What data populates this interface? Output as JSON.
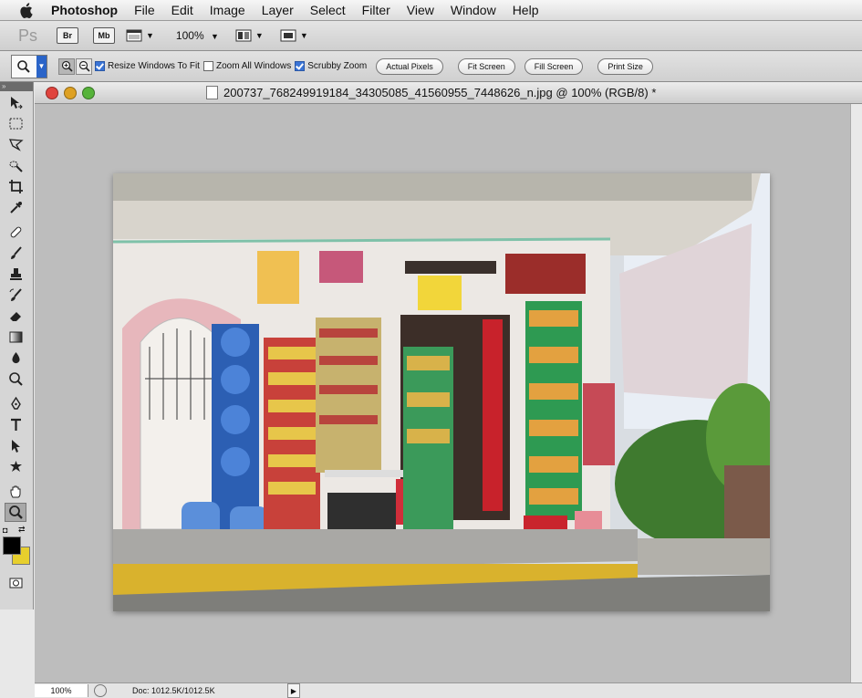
{
  "menubar": {
    "apple_icon": "apple-logo-icon",
    "items": [
      "Photoshop",
      "File",
      "Edit",
      "Image",
      "Layer",
      "Select",
      "Filter",
      "View",
      "Window",
      "Help"
    ]
  },
  "appbar": {
    "ps_logo": "Ps",
    "bridge": "Br",
    "mini_bridge": "Mb",
    "zoom": "100%"
  },
  "options": {
    "resize_windows": "Resize Windows To Fit",
    "resize_checked": true,
    "zoom_all": "Zoom All Windows",
    "zoom_all_checked": false,
    "scrubby": "Scrubby Zoom",
    "scrubby_checked": true,
    "actual_pixels": "Actual Pixels",
    "fit_screen": "Fit Screen",
    "fill_screen": "Fill Screen",
    "print_size": "Print Size"
  },
  "document": {
    "title": "200737_768249919184_34305085_41560955_7448626_n.jpg @ 100% (RGB/8) *"
  },
  "status": {
    "zoom": "100%",
    "doc_info": "Doc: 1012.5K/1012.5K"
  },
  "colors": {
    "foreground": "#000000",
    "background": "#e7cf2d",
    "close": "#e0443e",
    "minimize": "#dea123",
    "zoom": "#56b33a"
  }
}
